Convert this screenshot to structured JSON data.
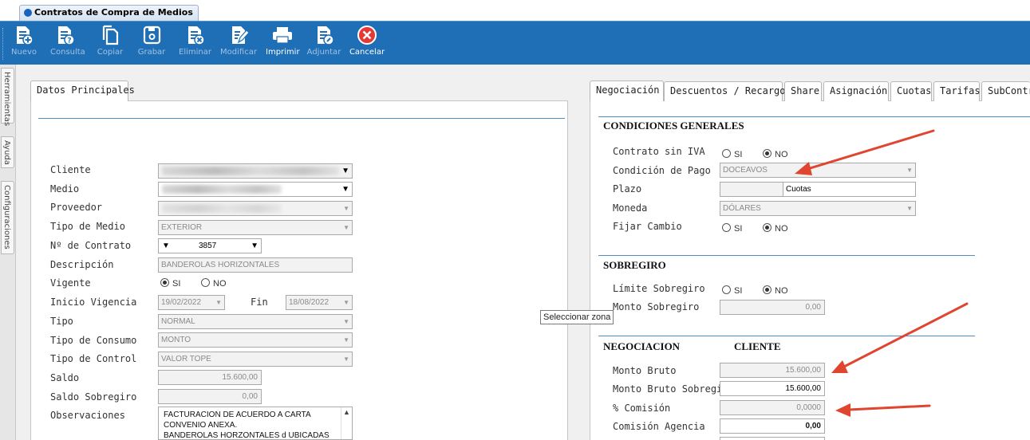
{
  "window": {
    "tab_title": "Contratos de Compra de Medios"
  },
  "toolbar": {
    "buttons": [
      {
        "label": "Nuevo",
        "icon": "doc-add-icon",
        "enabled": false
      },
      {
        "label": "Consulta",
        "icon": "doc-query-icon",
        "enabled": false
      },
      {
        "label": "Copiar",
        "icon": "copy-icon",
        "enabled": false
      },
      {
        "label": "Grabar",
        "icon": "save-icon",
        "enabled": false
      },
      {
        "label": "Eliminar",
        "icon": "doc-delete-icon",
        "enabled": false
      },
      {
        "label": "Modificar",
        "icon": "edit-icon",
        "enabled": false
      },
      {
        "label": "Imprimir",
        "icon": "printer-icon",
        "enabled": true
      },
      {
        "label": "Adjuntar",
        "icon": "attach-icon",
        "enabled": false
      },
      {
        "label": "Cancelar",
        "icon": "cancel-icon",
        "enabled": true
      }
    ]
  },
  "side_tabs": [
    "Herramientas",
    "Ayuda",
    "Configuraciones"
  ],
  "left_panel": {
    "tab": "Datos Principales",
    "labels": {
      "cliente": "Cliente",
      "medio": "Medio",
      "proveedor": "Proveedor",
      "tipo_medio": "Tipo de Medio",
      "nro_contrato": "Nº de Contrato",
      "descripcion": "Descripción",
      "vigente": "Vigente",
      "inicio_vigencia": "Inicio Vigencia",
      "fin": "Fin",
      "tipo": "Tipo",
      "tipo_consumo": "Tipo de Consumo",
      "tipo_control": "Tipo de Control",
      "saldo": "Saldo",
      "saldo_sobregiro": "Saldo Sobregiro",
      "observaciones": "Observaciones"
    },
    "values": {
      "tipo_medio": "EXTERIOR",
      "nro_contrato": "3857",
      "descripcion": "BANDEROLAS HORIZONTALES",
      "inicio_vigencia": "19/02/2022",
      "fin": "18/08/2022",
      "tipo": "NORMAL",
      "tipo_consumo": "MONTO",
      "tipo_control": "VALOR TOPE",
      "saldo": "15.600,00",
      "saldo_sobregiro": "0,00",
      "observaciones_lines": [
        "FACTURACION DE ACUERDO A CARTA",
        "CONVENIO ANEXA.",
        "BANDEROLAS HORZONTALES d UBICADAS EN"
      ]
    },
    "vigente_options": {
      "si": "SI",
      "no": "NO",
      "selected": "SI"
    }
  },
  "right_panel": {
    "tabs": [
      "Negociación",
      "Descuentos / Recargos",
      "Share",
      "Asignación",
      "Cuotas",
      "Tarifas",
      "SubContra"
    ],
    "active_tab": "Negociación",
    "condiciones": {
      "title": "CONDICIONES GENERALES",
      "contrato_sin_iva_label": "Contrato sin IVA",
      "condicion_pago_label": "Condición de Pago",
      "condicion_pago_value": "DOCEAVOS",
      "plazo_label": "Plazo",
      "plazo_value": "",
      "plazo_unit": "Cuotas",
      "moneda_label": "Moneda",
      "moneda_value": "DÓLARES",
      "fijar_cambio_label": "Fijar Cambio"
    },
    "sobregiro": {
      "title": "SOBREGIRO",
      "limite_label": "Límite Sobregiro",
      "monto_label": "Monto Sobregiro",
      "monto_value": "0,00"
    },
    "negociacion": {
      "title": "NEGOCIACION",
      "column": "CLIENTE",
      "monto_bruto_label": "Monto Bruto",
      "monto_bruto_value": "15.600,00",
      "monto_bruto_sobregiro_label": "Monto Bruto Sobregiro",
      "monto_bruto_sobregiro_value": "15.600,00",
      "comision_pct_label": "% Comisión",
      "comision_pct_value": "0,0000",
      "comision_agencia_label": "Comisión Agencia",
      "comision_agencia_value": "0,00"
    },
    "radio_si": "SI",
    "radio_no": "NO"
  },
  "tooltip": "Seleccionar zona",
  "colors": {
    "toolbar": "#1f6fb7",
    "accent_rule": "#4d8fc9",
    "annotation_arrow": "#e0452f"
  }
}
